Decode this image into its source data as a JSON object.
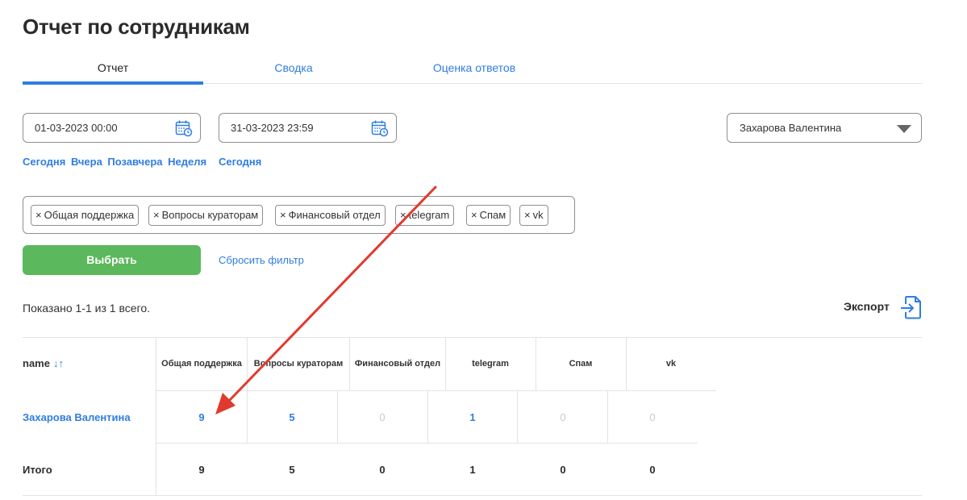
{
  "page": {
    "title": "Отчет по сотрудникам"
  },
  "tabs": [
    {
      "label": "Отчет",
      "active": true
    },
    {
      "label": "Сводка",
      "active": false
    },
    {
      "label": "Оценка ответов",
      "active": false
    }
  ],
  "filters": {
    "date_from": "01-03-2023 00:00",
    "date_to": "31-03-2023 23:59",
    "quick_from": [
      "Сегодня",
      "Вчера",
      "Позавчера",
      "Неделя"
    ],
    "quick_to": [
      "Сегодня"
    ],
    "employee": "Захарова Валентина",
    "tags": [
      "Общая поддержка",
      "Вопросы кураторам",
      "Финансовый отдел",
      "telegram",
      "Спам",
      "vk"
    ],
    "tag_remove_symbol": "×",
    "select_button": "Выбрать",
    "reset_link": "Сбросить фильтр"
  },
  "summary": {
    "shown_text": "Показано 1-1 из 1 всего.",
    "export_label": "Экспорт"
  },
  "table": {
    "name_header": "name",
    "sort_symbol": "↓↑",
    "columns": [
      "Общая поддержка",
      "Вопросы кураторам",
      "Финансовый отдел",
      "telegram",
      "Спам",
      "vk"
    ],
    "rows": [
      {
        "name": "Захарова Валентина",
        "values": [
          "9",
          "5",
          "0",
          "1",
          "0",
          "0"
        ]
      }
    ],
    "total": {
      "label": "Итого",
      "values": [
        "9",
        "5",
        "0",
        "1",
        "0",
        "0"
      ]
    }
  },
  "colors": {
    "accent": "#2f7de1",
    "button_green": "#5cb85c",
    "annotation_arrow": "#e03a2f"
  },
  "icons": {
    "calendar": "calendar-icon",
    "dropdown": "caret-down-icon",
    "export": "export-file-icon",
    "sort": "sort-icon"
  }
}
